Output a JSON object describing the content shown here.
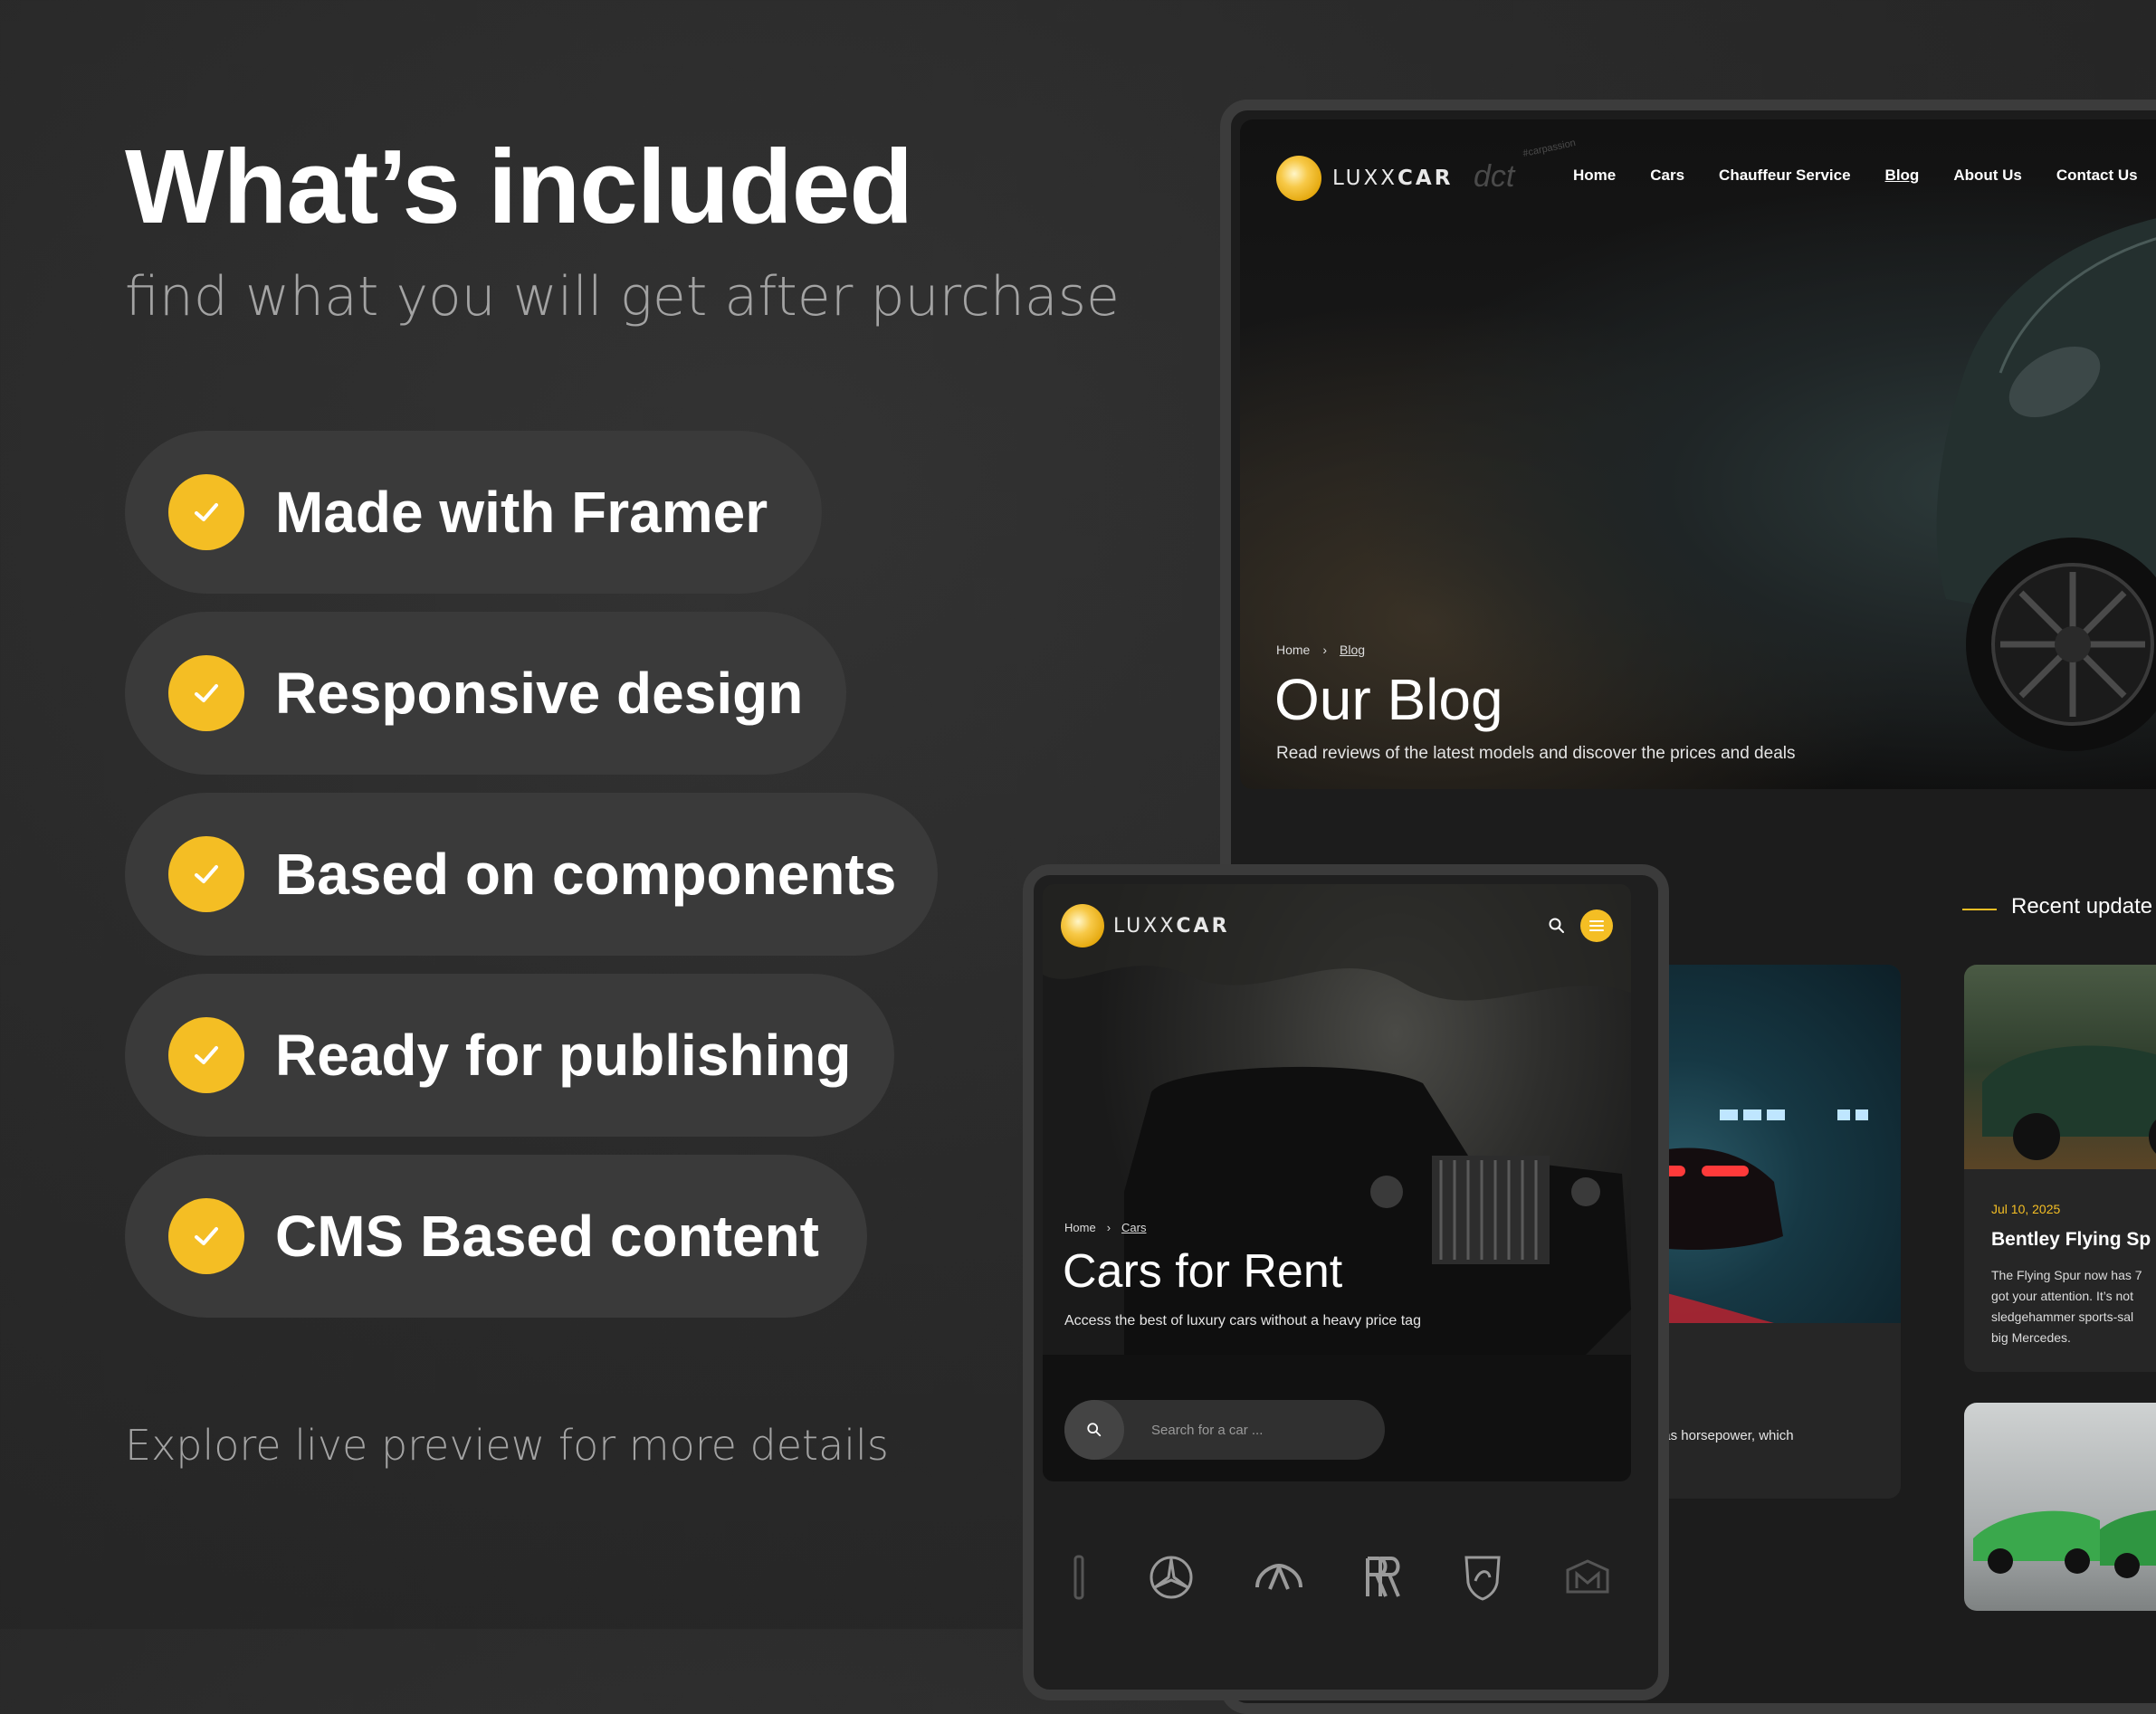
{
  "promo": {
    "headline": "What’s included",
    "subline": "find what you will get after purchase",
    "features": [
      "Made with Framer",
      "Responsive design",
      "Based on components",
      "Ready for publishing",
      "CMS Based content"
    ],
    "explore": "Explore live preview for more details",
    "accent": "#f4be24"
  },
  "desktop": {
    "brand_light": "LUXX",
    "brand_bold": "CAR",
    "watermark": "dct",
    "watermark_tag": "#carpassion",
    "nav": [
      "Home",
      "Cars",
      "Chauffeur Service",
      "Blog",
      "About Us",
      "Contact Us"
    ],
    "active_nav": "Blog",
    "breadcrumb": [
      "Home",
      "Blog"
    ],
    "title": "Our Blog",
    "subtitle": "Read reviews of the latest models and discover the prices and deals",
    "recent_label": "Recent update",
    "card_excerpt": "here’s such thing as horsepower, which",
    "side_card": {
      "date": "Jul 10, 2025",
      "title": "Bentley Flying Sp",
      "text": [
        "The Flying Spur now has 7",
        "got your attention. It’s not",
        "sledgehammer sports-sal",
        "big Mercedes."
      ]
    }
  },
  "tablet": {
    "brand_light": "LUXX",
    "brand_bold": "CAR",
    "breadcrumb": [
      "Home",
      "Cars"
    ],
    "title": "Cars for Rent",
    "subtitle": "Access the best of luxury cars without a heavy price tag",
    "search_placeholder": "Search for a car ...",
    "brand_icons": [
      "lincoln-icon",
      "mercedes-icon",
      "infiniti-icon",
      "rolls-royce-icon",
      "lamborghini-icon",
      "maybach-icon"
    ]
  }
}
